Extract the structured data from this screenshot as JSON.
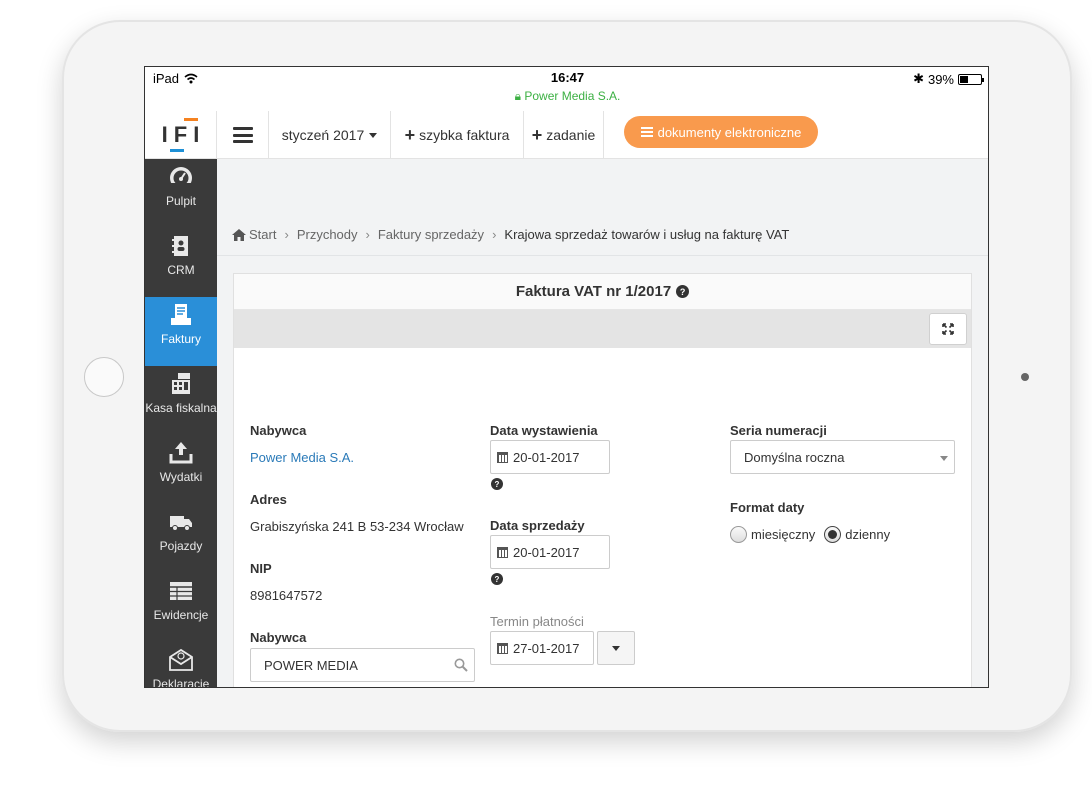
{
  "status_bar": {
    "device": "iPad",
    "time": "16:47",
    "site": "Power Media S.A.",
    "battery": "39%",
    "battery_level": 0.39
  },
  "topbar": {
    "logo": "IFI",
    "month_label": "styczeń 2017",
    "quick_invoice_label": "szybka faktura",
    "task_label": "zadanie",
    "edocs_label": "dokumenty elektroniczne"
  },
  "sidebar": {
    "items": [
      {
        "label": "Pulpit",
        "icon": "dashboard-icon"
      },
      {
        "label": "CRM",
        "icon": "contacts-book-icon"
      },
      {
        "label": "Faktury",
        "icon": "invoice-icon",
        "active": true
      },
      {
        "label": "Kasa fiskalna",
        "icon": "cash-register-icon"
      },
      {
        "label": "Wydatki",
        "icon": "upload-tray-icon"
      },
      {
        "label": "Pojazdy",
        "icon": "truck-icon"
      },
      {
        "label": "Ewidencje",
        "icon": "table-icon"
      },
      {
        "label": "Deklaracje",
        "icon": "envelope-icon"
      }
    ]
  },
  "breadcrumb": {
    "items": [
      "Start",
      "Przychody",
      "Faktury sprzedaży",
      "Krajowa sprzedaż towarów i usług na fakturę VAT"
    ]
  },
  "panel": {
    "title": "Faktura VAT nr 1/2017",
    "buyer_label": "Nabywca",
    "buyer_value": "Power Media S.A.",
    "address_label": "Adres",
    "address_value": "Grabiszyńska 241 B 53-234 Wrocław",
    "nip_label": "NIP",
    "nip_value": "8981647572",
    "buyer_search_label": "Nabywca",
    "buyer_search_value": "POWER MEDIA",
    "issue_date_label": "Data wystawienia",
    "issue_date_value": "20-01-2017",
    "sale_date_label": "Data sprzedaży",
    "sale_date_value": "20-01-2017",
    "payment_term_label": "Termin płatności",
    "payment_term_value": "27-01-2017",
    "series_label": "Seria numeracji",
    "series_value": "Domyślna roczna",
    "date_format_label": "Format daty",
    "date_format_options": [
      "miesięczny",
      "dzienny"
    ],
    "date_format_selected": "dzienny"
  }
}
